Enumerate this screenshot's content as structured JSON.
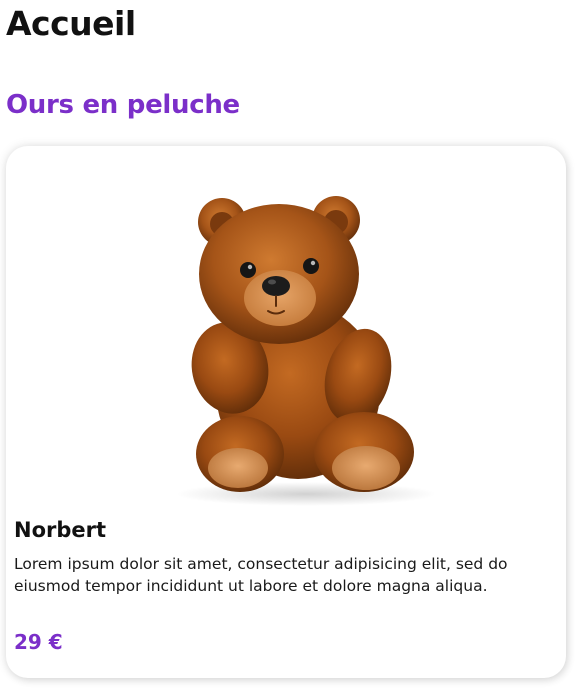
{
  "page": {
    "title": "Accueil"
  },
  "section": {
    "title": "Ours en peluche",
    "accent_color": "#7b2fc9"
  },
  "product": {
    "image_subject": "teddy-bear",
    "name": "Norbert",
    "description": "Lorem ipsum dolor sit amet, consectetur adipisicing elit, sed do eiusmod tempor incididunt ut labore et dolore magna aliqua.",
    "price": "29 €"
  }
}
